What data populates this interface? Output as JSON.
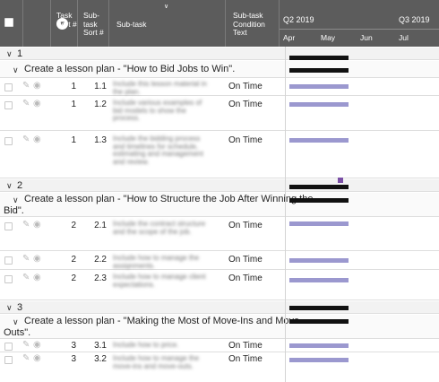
{
  "header": {
    "task_sort": "Task Sort #",
    "subtask_sort": "Sub-task Sort #",
    "subtask": "Sub-task",
    "condition": "Sub-task Condition Text",
    "quarters": [
      "Q2 2019",
      "Q3 2019"
    ],
    "months": [
      "Apr",
      "May",
      "Jun",
      "Jul"
    ]
  },
  "groups": [
    {
      "num": "1",
      "task": "Create a lesson plan - \"How to Bid Jobs to Win\".",
      "task_line2": "",
      "subtasks": [
        {
          "task_sort": "1",
          "sort": "1.1",
          "text": "Include this lesson material in the plan.",
          "condition": "On Time"
        },
        {
          "task_sort": "1",
          "sort": "1.2",
          "text": "Include various examples of bid models to show the process.",
          "condition": "On Time"
        },
        {
          "task_sort": "1",
          "sort": "1.3",
          "text": "Include the bidding process and timelines for schedule, estimating and management and review.",
          "condition": "On Time"
        }
      ]
    },
    {
      "num": "2",
      "task": "Create a lesson plan - \"How to Structure the Job After Winning the",
      "task_line2": "Bid\".",
      "subtasks": [
        {
          "task_sort": "2",
          "sort": "2.1",
          "text": "Include the contract structure and the scope of the job.",
          "condition": "On Time"
        },
        {
          "task_sort": "2",
          "sort": "2.2",
          "text": "Include how to manage the assignments.",
          "condition": "On Time"
        },
        {
          "task_sort": "2",
          "sort": "2.3",
          "text": "Include how to manage client expectations.",
          "condition": "On Time"
        }
      ]
    },
    {
      "num": "3",
      "task": "Create a lesson plan - \"Making the Most of Move-Ins and Move-",
      "task_line2": "Outs\".",
      "subtasks": [
        {
          "task_sort": "3",
          "sort": "3.1",
          "text": "Include how to price.",
          "condition": "On Time"
        },
        {
          "task_sort": "3",
          "sort": "3.2",
          "text": "Include how to manage the move-ins and move-outs.",
          "condition": "On Time"
        }
      ]
    }
  ],
  "colors": {
    "header_bg": "#5c5c5c",
    "summary_bar": "#111111",
    "subtask_bar": "#9b98cf",
    "milestone": "#7a4fa5"
  }
}
